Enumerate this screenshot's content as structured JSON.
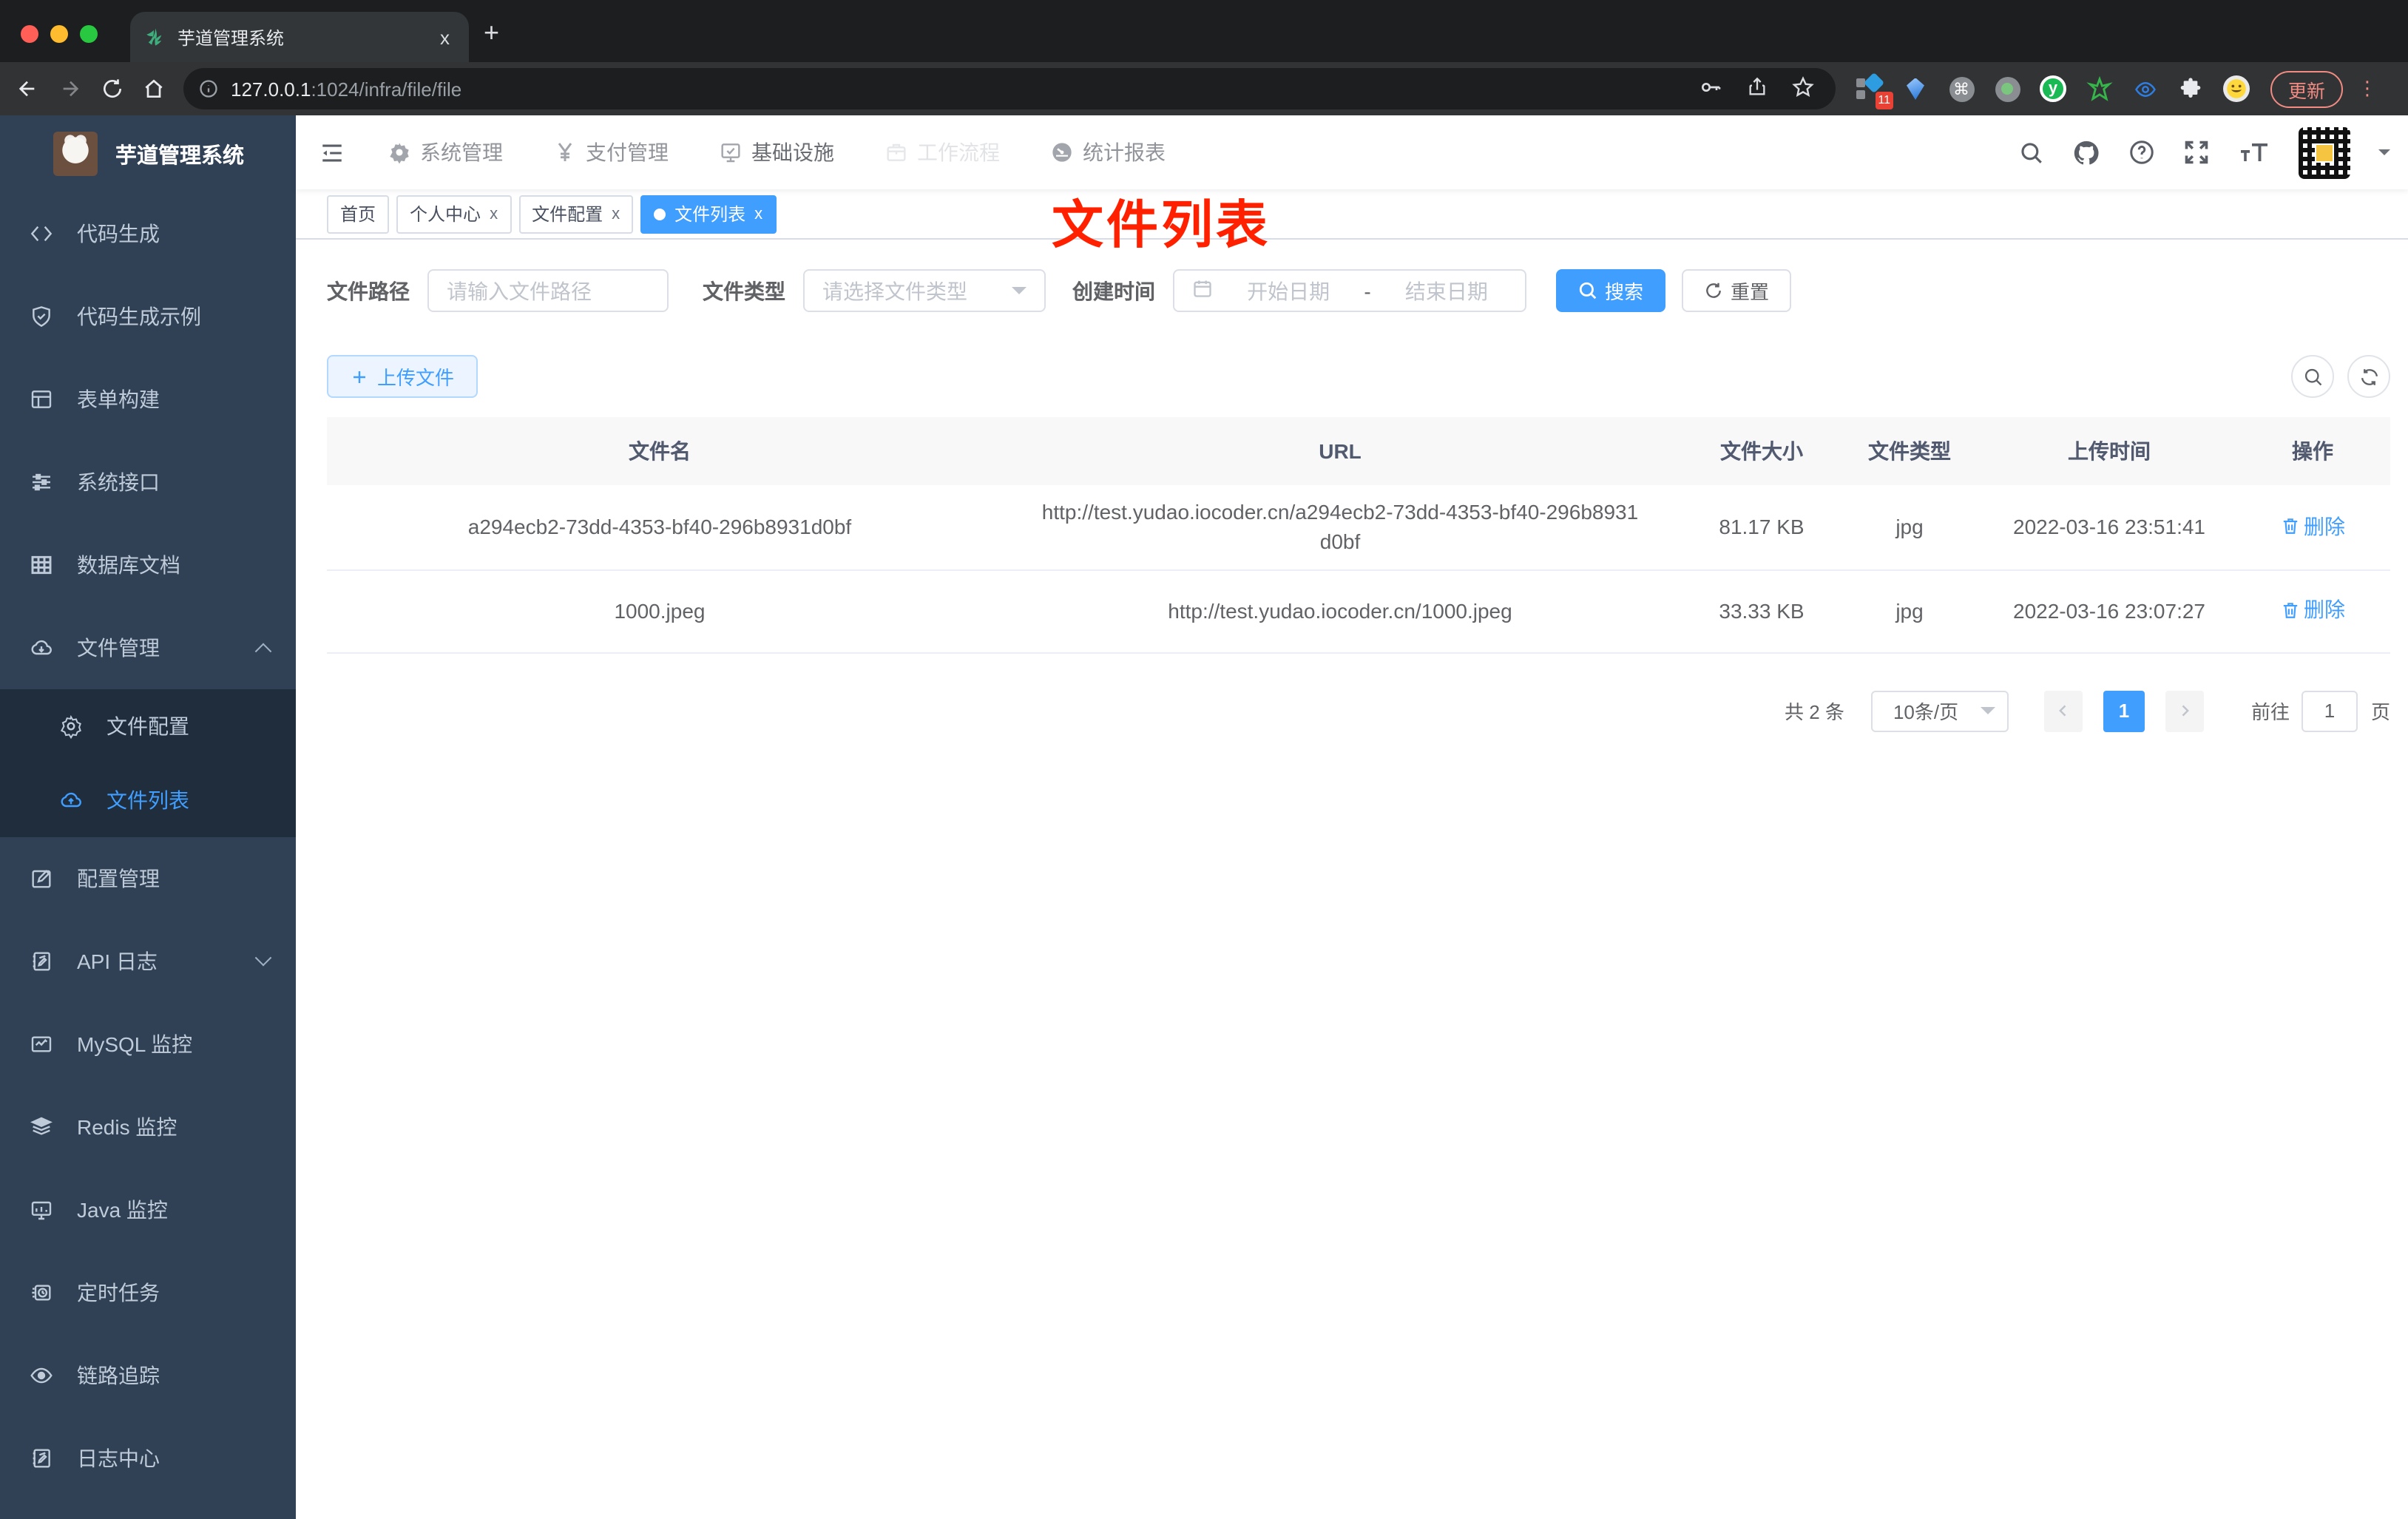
{
  "browser": {
    "tab_title": "芋道管理系统",
    "tab_close": "x",
    "new_tab": "+",
    "url_host": "127.0.0.1",
    "url_path": ":1024/infra/file/file",
    "extension_badge": "11",
    "cmd_glyph": "⌘",
    "y_glyph": "y",
    "update_label": "更新",
    "kebab_glyph": "⋮"
  },
  "sidebar": {
    "title": "芋道管理系统",
    "items": [
      {
        "label": "代码生成",
        "icon": "code-icon",
        "name": "code-generation"
      },
      {
        "label": "代码生成示例",
        "icon": "shield-check-icon",
        "name": "code-generation-example"
      },
      {
        "label": "表单构建",
        "icon": "form-icon",
        "name": "form-builder"
      },
      {
        "label": "系统接口",
        "icon": "sliders-icon",
        "name": "system-api"
      },
      {
        "label": "数据库文档",
        "icon": "db-table-icon",
        "name": "db-doc"
      },
      {
        "label": "文件管理",
        "icon": "cloud-down-icon",
        "chevron": "up",
        "name": "file-management"
      },
      {
        "label": "文件配置",
        "icon": "gear-line-icon",
        "sub": true,
        "name": "file-config"
      },
      {
        "label": "文件列表",
        "icon": "cloud-up-icon",
        "sub": true,
        "active": true,
        "name": "file-list"
      },
      {
        "label": "配置管理",
        "icon": "edit-icon",
        "name": "config-management"
      },
      {
        "label": "API 日志",
        "icon": "log-icon",
        "chevron": "down",
        "name": "api-log"
      },
      {
        "label": "MySQL 监控",
        "icon": "chart-icon",
        "name": "mysql-monitor"
      },
      {
        "label": "Redis 监控",
        "icon": "layers-icon",
        "name": "redis-monitor"
      },
      {
        "label": "Java 监控",
        "icon": "monitor-icon",
        "name": "java-monitor"
      },
      {
        "label": "定时任务",
        "icon": "timer-icon",
        "name": "scheduled-task"
      },
      {
        "label": "链路追踪",
        "icon": "eye-icon",
        "name": "tracing"
      },
      {
        "label": "日志中心",
        "icon": "log-icon",
        "name": "log-center"
      }
    ]
  },
  "topnav": {
    "menus": [
      {
        "label": "系统管理",
        "icon": "gear-fill-icon",
        "name": "system-management"
      },
      {
        "label": "支付管理",
        "icon": "yen-icon",
        "name": "payment-management"
      },
      {
        "label": "基础设施",
        "icon": "monitor-check-icon",
        "active": true,
        "name": "infrastructure"
      },
      {
        "label": "工作流程",
        "icon": "briefcase-icon",
        "dim": true,
        "name": "workflow"
      },
      {
        "label": "统计报表",
        "icon": "dashboard-icon",
        "name": "statistics-report"
      }
    ]
  },
  "tags": [
    {
      "label": "首页",
      "closable": false,
      "active": false
    },
    {
      "label": "个人中心",
      "closable": true,
      "active": false
    },
    {
      "label": "文件配置",
      "closable": true,
      "active": false
    },
    {
      "label": "文件列表",
      "closable": true,
      "active": true
    }
  ],
  "annotation": "文件列表",
  "filters": {
    "path_label": "文件路径",
    "path_placeholder": "请输入文件路径",
    "type_label": "文件类型",
    "type_placeholder": "请选择文件类型",
    "date_label": "创建时间",
    "date_start_placeholder": "开始日期",
    "date_separator": "-",
    "date_end_placeholder": "结束日期",
    "search_label": "搜索",
    "reset_label": "重置"
  },
  "toolbar": {
    "upload_label": "上传文件"
  },
  "table": {
    "columns": [
      "文件名",
      "URL",
      "文件大小",
      "文件类型",
      "上传时间",
      "操作"
    ],
    "rows": [
      {
        "name": "a294ecb2-73dd-4353-bf40-296b8931d0bf",
        "url": "http://test.yudao.iocoder.cn/a294ecb2-73dd-4353-bf40-296b8931d0bf",
        "size": "81.17 KB",
        "type": "jpg",
        "time": "2022-03-16 23:51:41",
        "action": "删除"
      },
      {
        "name": "1000.jpeg",
        "url": "http://test.yudao.iocoder.cn/1000.jpeg",
        "size": "33.33 KB",
        "type": "jpg",
        "time": "2022-03-16 23:07:27",
        "action": "删除"
      }
    ]
  },
  "pagination": {
    "total": "共 2 条",
    "page_size": "10条/页",
    "current_page": "1",
    "goto_label": "前往",
    "goto_value": "1",
    "unit_label": "页"
  }
}
